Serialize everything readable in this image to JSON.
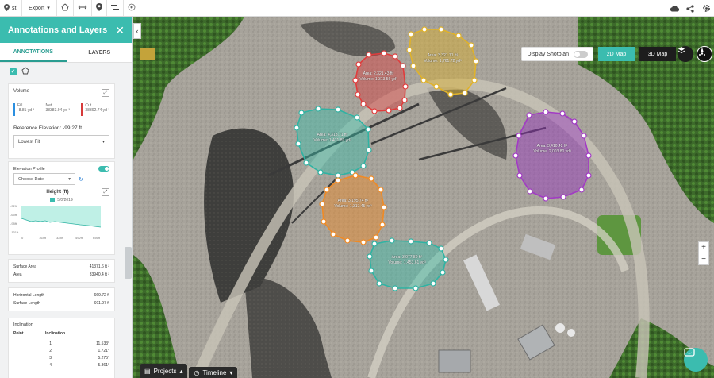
{
  "toolbar": {
    "location": "stl",
    "export_label": "Export",
    "tools": [
      "location-pin-icon",
      "export-icon",
      "polygon-icon",
      "measure-icon",
      "marker-icon",
      "crop-icon",
      "target-icon"
    ],
    "right_icons": [
      "cloud-icon",
      "share-icon",
      "settings-icon"
    ]
  },
  "sidebar": {
    "title": "Annotations and Layers",
    "tabs": [
      "ANNOTATIONS",
      "LAYERS"
    ],
    "volume": {
      "heading": "Volume",
      "cut_fill": [
        {
          "label": "Fill",
          "value": "-8.81 yd ³"
        },
        {
          "label": "Net",
          "value": "38383.94 yd ³"
        },
        {
          "label": "Cut",
          "value": "38392.74 yd ³"
        }
      ],
      "reference_elevation": "Reference Elevation:  -99.27 ft",
      "fit_select": "Lowest Fit"
    },
    "elevation": {
      "heading": "Elevation Profile",
      "date_select": "Choose Date",
      "chart_title": "Height (ft)",
      "legend_date": "5/0/2019",
      "y_ticks": [
        "-32ft",
        "-65ft",
        "-98ft",
        "-131ft"
      ],
      "x_ticks": [
        "0",
        "164ft",
        "328ft",
        "492ft",
        "656ft"
      ]
    },
    "area": {
      "rows": [
        {
          "label": "Surface Area",
          "value": "41371.6 ft ²"
        },
        {
          "label": "Area",
          "value": "33940.4 ft ²"
        }
      ]
    },
    "length": {
      "rows": [
        {
          "label": "Horizontal Length",
          "value": "669.72 ft"
        },
        {
          "label": "Surface Length",
          "value": "911.97 ft"
        }
      ]
    },
    "inclination": {
      "heading": "Inclination",
      "columns": [
        "Point",
        "Inclination"
      ],
      "rows": [
        {
          "point": "1",
          "value": "11.533°"
        },
        {
          "point": "2",
          "value": "1.721°"
        },
        {
          "point": "3",
          "value": "5.275°"
        },
        {
          "point": "4",
          "value": "5.361°"
        }
      ]
    }
  },
  "map": {
    "shotplan_label": "Display Shotplan",
    "view_2d": "2D Map",
    "view_3d": "3D Map",
    "zoom_in": "+",
    "zoom_out": "−",
    "projects_label": "Projects",
    "timeline_label": "Timeline",
    "colors": {
      "red": "#e03c3c",
      "gold": "#e0b22a",
      "teal": "#2fb3a3",
      "orange": "#f08a24",
      "purple": "#a23bc4",
      "accent": "#3bbcaf"
    },
    "polygons": [
      {
        "color": "red",
        "line1": "Area: 2,321.43 ft²",
        "line2": "Volume: 1,313.56 yd³"
      },
      {
        "color": "gold",
        "line1": "Area: 3,321.71 ft²",
        "line2": "Volume: 1,761.72 yd³"
      },
      {
        "color": "teal",
        "line1": "Area: 4,313.71 ft²",
        "line2": "Volume: 1,471.89 yd³"
      },
      {
        "color": "purple",
        "line1": "Area: 3,410.42 ft²",
        "line2": "Volume: 2,003.80 yd³"
      },
      {
        "color": "orange",
        "line1": "Area: 3,195.74 ft²",
        "line2": "Volume: 1,317.45 yd³"
      },
      {
        "color": "teal",
        "line1": "Area: 3,077.89 ft²",
        "line2": "Volume: 1,453.61 yd³"
      }
    ]
  }
}
